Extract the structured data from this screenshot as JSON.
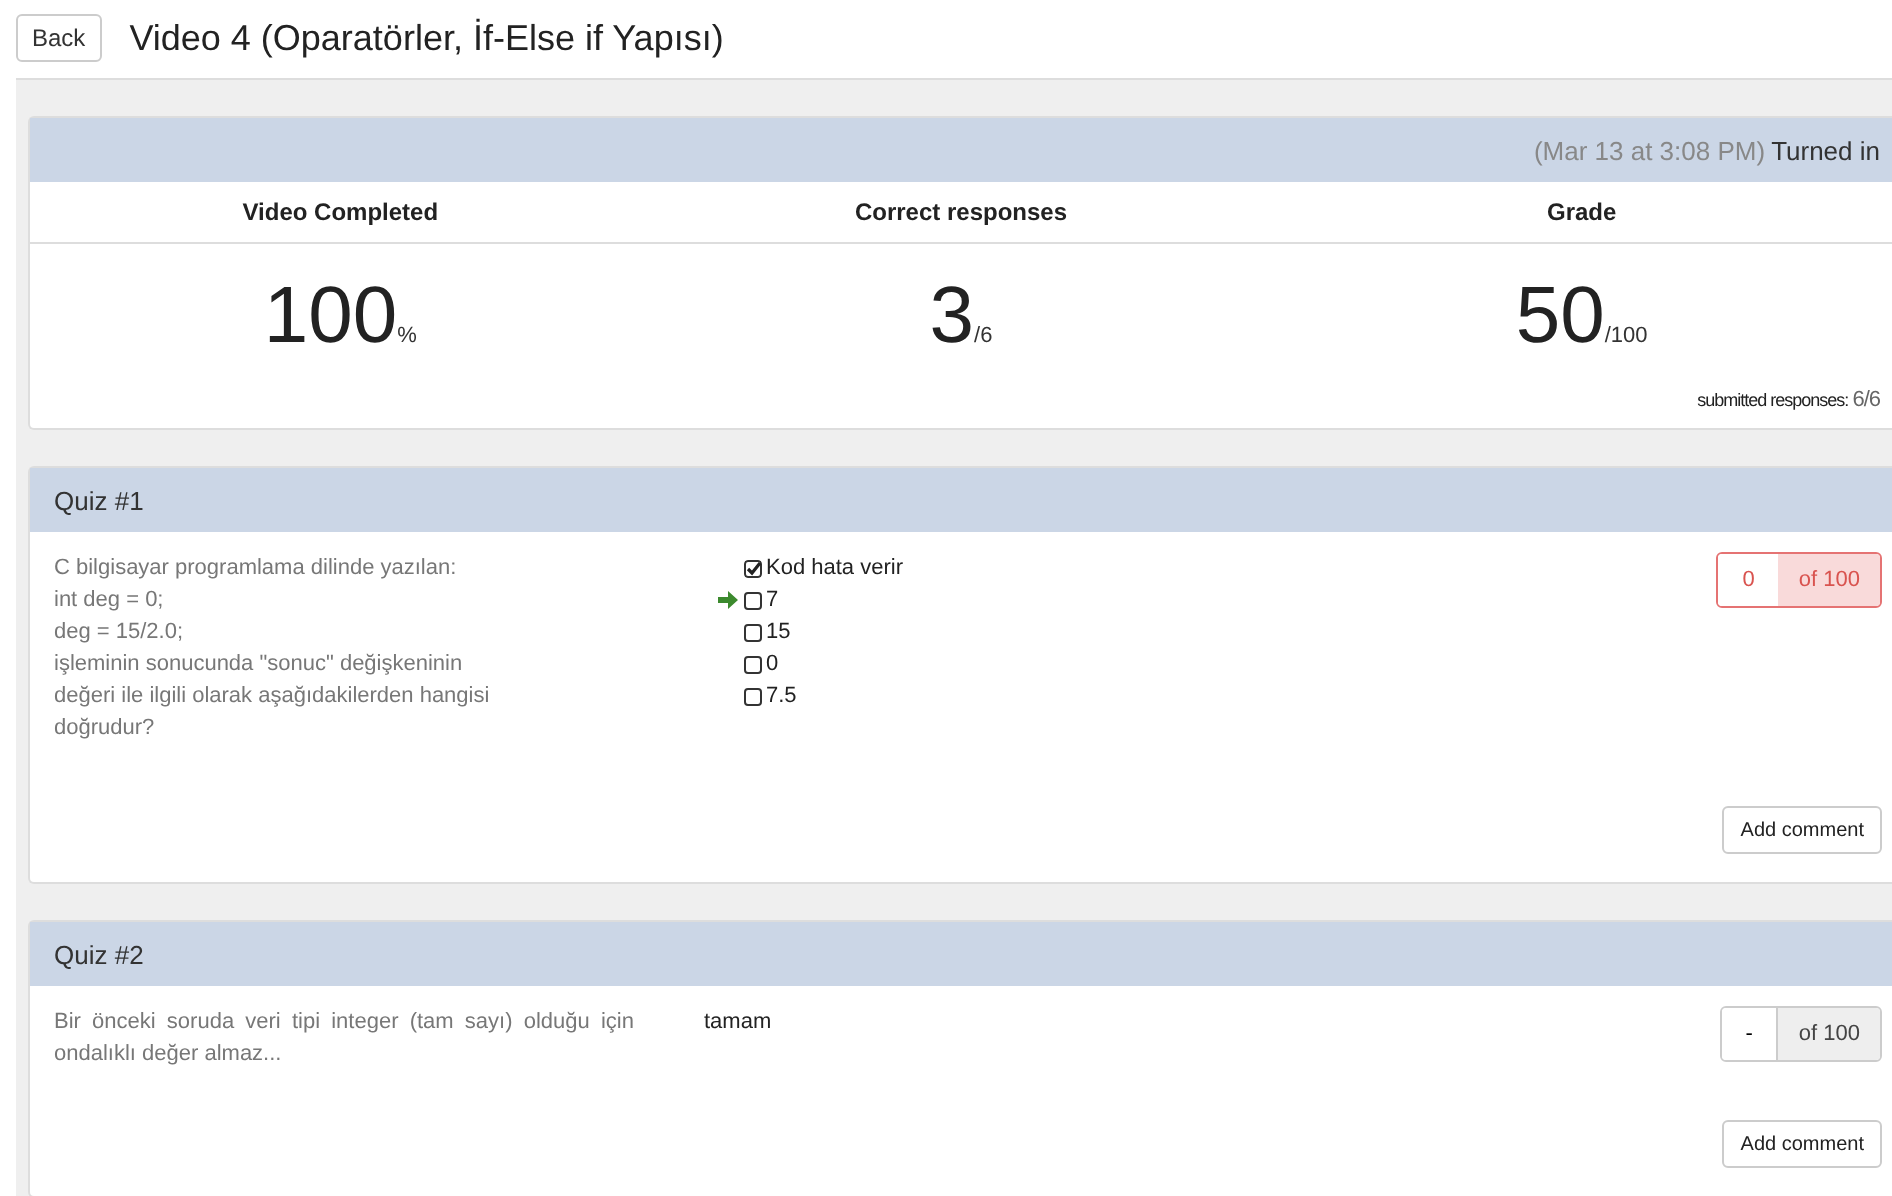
{
  "header": {
    "back_button": "Back",
    "title": "Video 4 (Oparatörler, İf-Else if Yapısı)"
  },
  "summary": {
    "submitted_time": "(Mar 13 at 3:08 PM)",
    "status": "Turned in",
    "stats": [
      {
        "label": "Video Completed",
        "value": "100",
        "unit": "%"
      },
      {
        "label": "Correct responses",
        "value": "3",
        "unit": "/6"
      },
      {
        "label": "Grade",
        "value": "50",
        "unit": "/100"
      }
    ],
    "submitted_label": "submitted responses:",
    "submitted_value": "6/6"
  },
  "quizzes": [
    {
      "title": "Quiz #1",
      "kind": "choice",
      "question": [
        "C bilgisayar programlama dilinde yazılan:",
        "int deg = 0;",
        "deg = 15/2.0;",
        "işleminin sonucunda \"sonuc\" değişkeninin",
        "değeri ile ilgili olarak aşağıdakilerden hangisi",
        "doğrudur?"
      ],
      "options": [
        {
          "label": "Kod hata verir",
          "checked": true,
          "correct": false
        },
        {
          "label": "7",
          "checked": false,
          "correct": true
        },
        {
          "label": "15",
          "checked": false,
          "correct": false
        },
        {
          "label": "0",
          "checked": false,
          "correct": false
        },
        {
          "label": "7.5",
          "checked": false,
          "correct": false
        }
      ],
      "score": "0",
      "score_total": "of 100",
      "wrong": true,
      "comment_button": "Add comment"
    },
    {
      "title": "Quiz #2",
      "kind": "text",
      "question": [
        "Bir önceki soruda veri tipi integer (tam sayı) olduğu için ondalıklı değer almaz..."
      ],
      "answer": "tamam",
      "score": "-",
      "score_total": "of 100",
      "wrong": false,
      "comment_button": "Add comment"
    }
  ]
}
